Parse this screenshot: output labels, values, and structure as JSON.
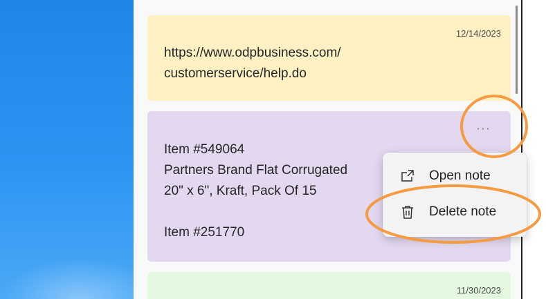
{
  "notes": [
    {
      "color": "#fdf1c4",
      "date": "12/14/2023",
      "text": "https://www.odpbusiness.com/\ncustomerservice/help.do"
    },
    {
      "color": "#e3d8f0",
      "more_label": "···",
      "text": "Item #549064\nPartners Brand Flat Corrugated\n20\" x 6\", Kraft, Pack Of 15\n\nItem #251770"
    },
    {
      "color": "#e4f7df",
      "date": "11/30/2023"
    }
  ],
  "context_menu": {
    "items": [
      {
        "icon": "open-external-icon",
        "label": "Open note"
      },
      {
        "icon": "trash-icon",
        "label": "Delete note"
      }
    ]
  },
  "annotations": {
    "highlight_color": "#f59b42"
  }
}
